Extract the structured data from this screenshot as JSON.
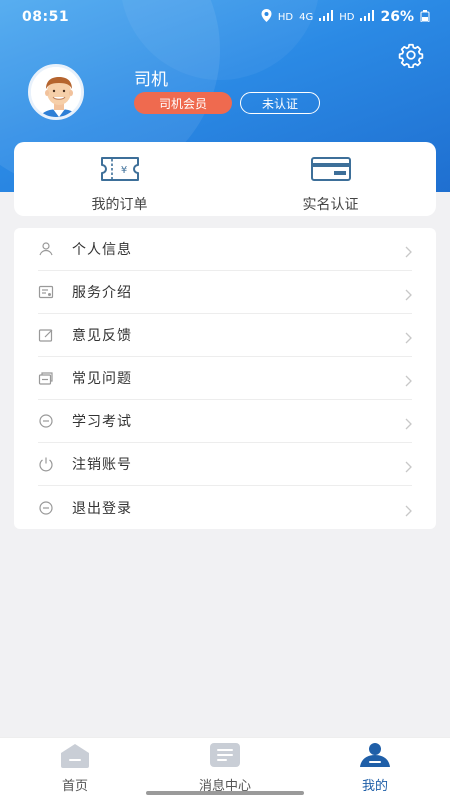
{
  "status_bar": {
    "time": "08:51",
    "hd1": "HD",
    "hd2": "HD",
    "net": "4G",
    "battery": "26%"
  },
  "profile": {
    "name": "司机",
    "member_tag": "司机会员",
    "verify_tag": "未认证"
  },
  "quick_actions": [
    {
      "label": "我的订单",
      "icon": "ticket-icon"
    },
    {
      "label": "实名认证",
      "icon": "id-card-icon"
    }
  ],
  "menu": [
    {
      "label": "个人信息",
      "icon": "person-icon"
    },
    {
      "label": "服务介绍",
      "icon": "document-icon"
    },
    {
      "label": "意见反馈",
      "icon": "edit-icon"
    },
    {
      "label": "常见问题",
      "icon": "question-icon"
    },
    {
      "label": "学习考试",
      "icon": "exam-icon"
    },
    {
      "label": "注销账号",
      "icon": "power-icon"
    },
    {
      "label": "退出登录",
      "icon": "logout-icon"
    }
  ],
  "tabbar": {
    "tabs": [
      {
        "label": "首页",
        "icon": "home-icon"
      },
      {
        "label": "消息中心",
        "icon": "message-icon"
      },
      {
        "label": "我的",
        "icon": "profile-icon"
      }
    ],
    "active_index": 2
  },
  "colors": {
    "header_blue": "#2b8ae5",
    "member_tag": "#ef6a4f",
    "active_tab": "#1f5fa8"
  }
}
